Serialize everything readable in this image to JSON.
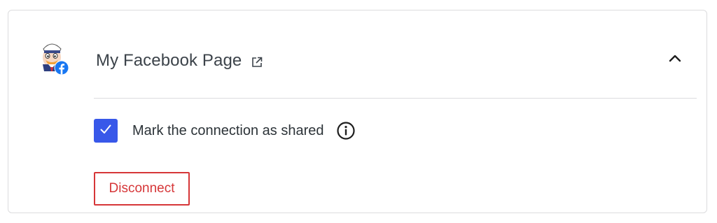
{
  "connection": {
    "page_name": "My Facebook Page",
    "service_icon": "facebook-badge-icon",
    "avatar_icon": "sailor-duck-avatar",
    "external_link_icon": "external-link-icon",
    "collapse_icon": "chevron-up-icon"
  },
  "shared": {
    "checked": true,
    "label": "Mark the connection as shared",
    "info_icon": "info-icon"
  },
  "actions": {
    "disconnect_label": "Disconnect"
  },
  "colors": {
    "accent": "#3858e9",
    "facebook": "#1877f2",
    "danger": "#d63638",
    "border": "#dcdcde",
    "text": "#3c434a"
  }
}
